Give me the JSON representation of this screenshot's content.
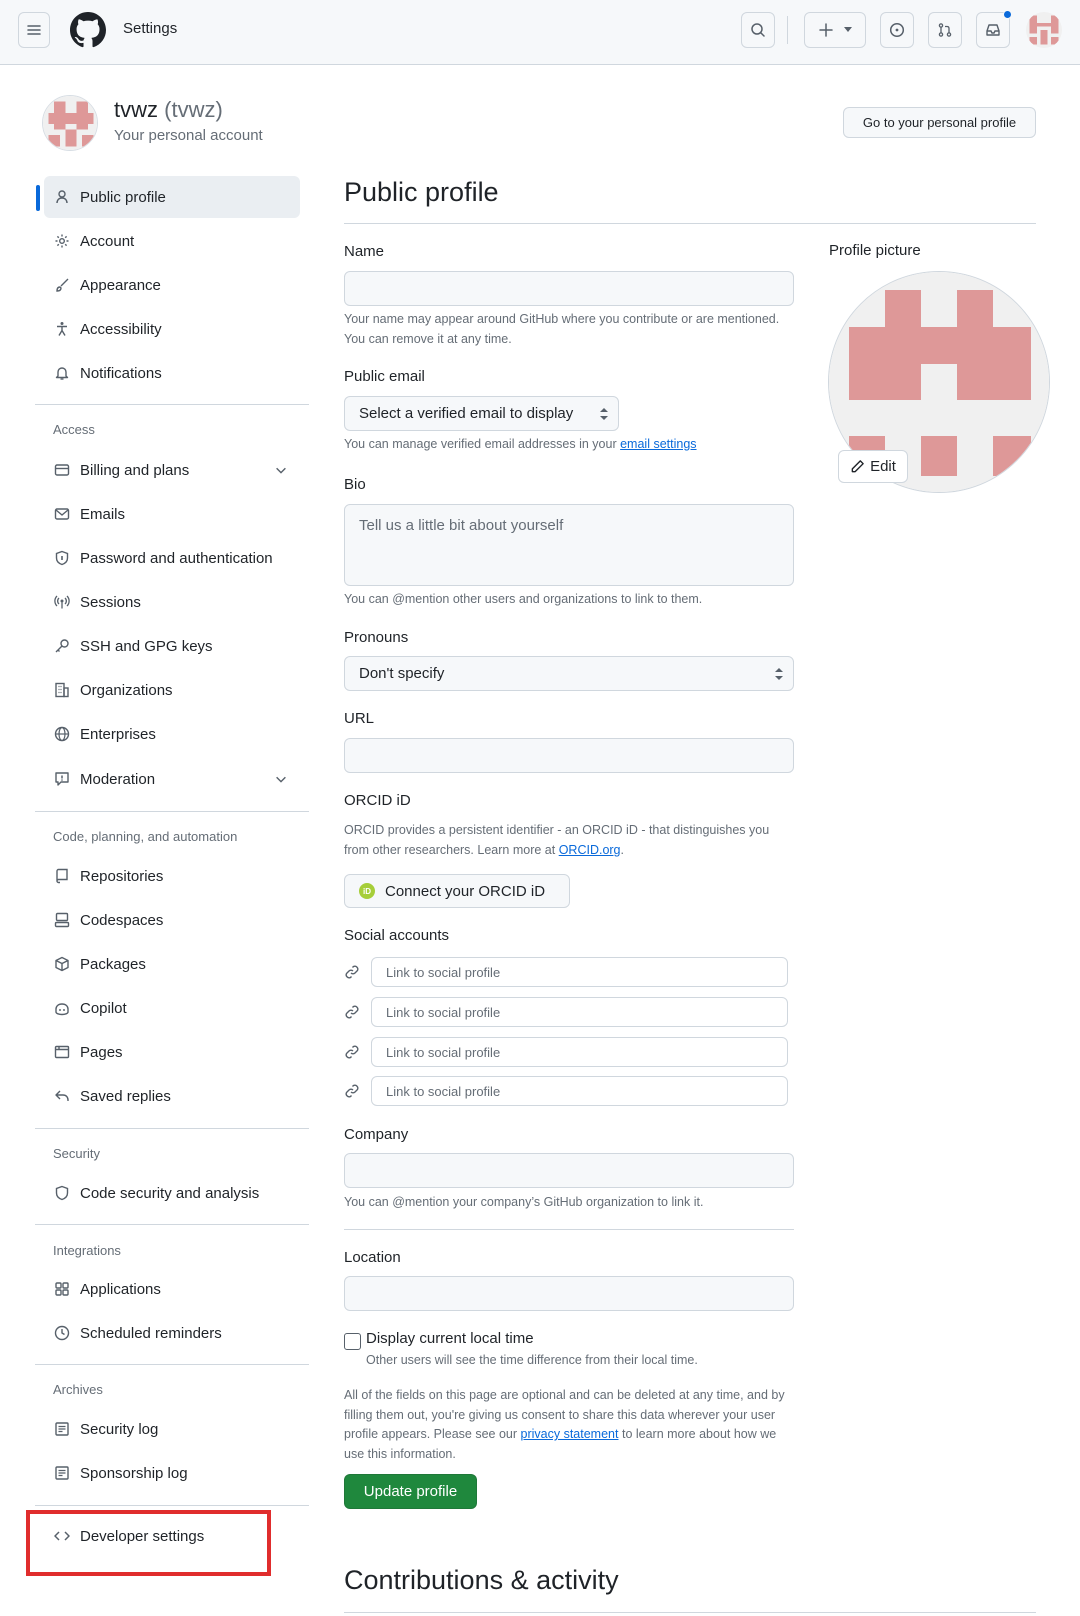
{
  "header": {
    "title": "Settings",
    "menu_icon": "hamburger-icon",
    "logo": "github-logo-icon",
    "actions": [
      "search-icon",
      "plus-icon",
      "issue-icon",
      "pull-request-icon",
      "inbox-icon"
    ]
  },
  "user": {
    "name": "tvwz",
    "login": "(tvwz)",
    "subtitle": "Your personal account",
    "goto_profile": "Go to your personal profile"
  },
  "sidebar": {
    "items": [
      {
        "label": "Public profile",
        "icon": "person-icon"
      },
      {
        "label": "Account",
        "icon": "gear-icon"
      },
      {
        "label": "Appearance",
        "icon": "paintbrush-icon"
      },
      {
        "label": "Accessibility",
        "icon": "accessibility-icon"
      },
      {
        "label": "Notifications",
        "icon": "bell-icon"
      }
    ],
    "sections": [
      {
        "heading": "Access",
        "items": [
          {
            "label": "Billing and plans",
            "icon": "credit-card-icon"
          },
          {
            "label": "Emails",
            "icon": "mail-icon"
          },
          {
            "label": "Password and authentication",
            "icon": "shield-lock-icon"
          },
          {
            "label": "Sessions",
            "icon": "broadcast-icon"
          },
          {
            "label": "SSH and GPG keys",
            "icon": "key-icon"
          },
          {
            "label": "Organizations",
            "icon": "organization-icon"
          },
          {
            "label": "Enterprises",
            "icon": "globe-icon"
          },
          {
            "label": "Moderation",
            "icon": "report-icon"
          }
        ]
      },
      {
        "heading": "Code, planning, and automation",
        "items": [
          {
            "label": "Repositories",
            "icon": "repo-icon"
          },
          {
            "label": "Codespaces",
            "icon": "codespaces-icon"
          },
          {
            "label": "Packages",
            "icon": "package-icon"
          },
          {
            "label": "Copilot",
            "icon": "copilot-icon"
          },
          {
            "label": "Pages",
            "icon": "browser-icon"
          },
          {
            "label": "Saved replies",
            "icon": "reply-icon"
          }
        ]
      },
      {
        "heading": "Security",
        "items": [
          {
            "label": "Code security and analysis",
            "icon": "shield-icon"
          }
        ]
      },
      {
        "heading": "Integrations",
        "items": [
          {
            "label": "Applications",
            "icon": "apps-icon"
          },
          {
            "label": "Scheduled reminders",
            "icon": "clock-icon"
          }
        ]
      },
      {
        "heading": "Archives",
        "items": [
          {
            "label": "Security log",
            "icon": "log-icon"
          },
          {
            "label": "Sponsorship log",
            "icon": "log-icon"
          }
        ]
      }
    ],
    "developer_settings": {
      "label": "Developer settings",
      "icon": "code-icon"
    }
  },
  "main": {
    "title": "Public profile",
    "name_label": "Name",
    "name_value": "",
    "name_note": "Your name may appear around GitHub where you contribute or are mentioned. You can remove it at any time.",
    "email_label": "Public email",
    "email_select": "Select a verified email to display",
    "email_note": "You can manage verified email addresses in your",
    "email_link": "email settings",
    "bio_label": "Bio",
    "bio_placeholder": "Tell us a little bit about yourself",
    "bio_note": "You can @mention other users and organizations to link to them.",
    "pronouns_label": "Pronouns",
    "pronouns_value": "Don't specify",
    "url_label": "URL",
    "url_value": "",
    "orcid_label": "ORCID iD",
    "orcid_note": "ORCID provides a persistent identifier - an ORCID iD - that distinguishes you from other researchers. Learn more at",
    "orcid_link": "ORCID.org",
    "orcid_button": "Connect your ORCID iD",
    "social_label": "Social accounts",
    "social_placeholders": [
      "Link to social profile",
      "Link to social profile",
      "Link to social profile",
      "Link to social profile"
    ],
    "company_label": "Company",
    "company_value": "",
    "company_note": "You can @mention your company’s GitHub organization to link it.",
    "location_label": "Location",
    "location_value": "",
    "local_time_label": "Display current local time",
    "local_time_checked": false,
    "local_time_note": "Other users will see the time difference from their local time.",
    "disclaimer": "All of the fields on this page are optional and can be deleted at any time, and by filling them out, you're giving us consent to share this data wherever your user profile appears. Please see our",
    "disclaimer_link": "privacy statement",
    "disclaimer_end": "to learn more about how we use this information.",
    "update_button": "Update profile",
    "contributions_title": "Contributions & activity"
  },
  "profile_picture": {
    "label": "Profile picture",
    "edit_button": "Edit"
  },
  "colors": {
    "accent": "#0969da",
    "primary_button": "#1f883d",
    "avatar_pink": "#de9898",
    "highlight_box": "#e02d2d"
  }
}
